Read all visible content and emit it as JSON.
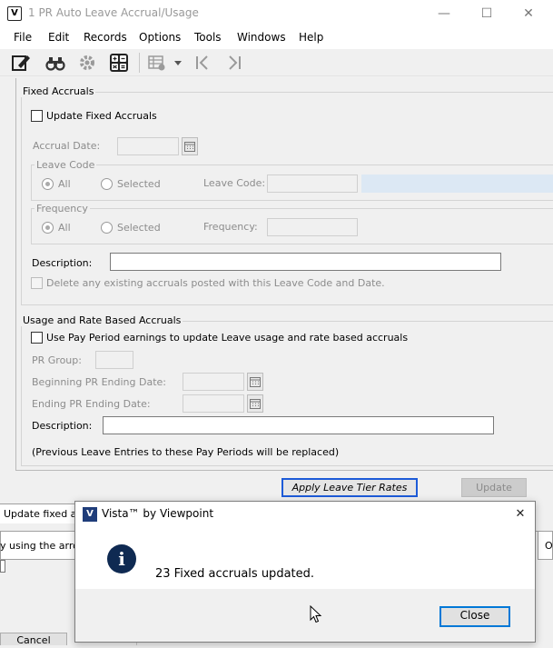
{
  "window": {
    "title": "1 PR Auto Leave Accrual/Usage",
    "controls": {
      "minimize": "—",
      "maximize": "☐",
      "close": "✕"
    }
  },
  "menu": {
    "items": [
      "File",
      "Edit",
      "Records",
      "Options",
      "Tools",
      "Windows",
      "Help"
    ]
  },
  "toolbar": {
    "icons": [
      "edit-note-icon",
      "binoculars-icon",
      "gear-icon",
      "calculator-icon",
      "grid-settings-icon",
      "dropdown-arrow-icon",
      "first-record-icon",
      "last-record-icon"
    ]
  },
  "fixed_accruals": {
    "group_title": "Fixed Accruals",
    "update_checkbox_label": "Update Fixed Accruals",
    "accrual_date_label": "Accrual Date:",
    "accrual_date_value": "",
    "leave_code_group_title": "Leave Code",
    "leave_code_all": "All",
    "leave_code_selected": "Selected",
    "leave_code_field_label": "Leave Code:",
    "leave_code_value": "",
    "frequency_group_title": "Frequency",
    "frequency_all": "All",
    "frequency_selected": "Selected",
    "frequency_field_label": "Frequency:",
    "frequency_value": "",
    "description_label": "Description:",
    "description_value": "",
    "delete_checkbox_label": "Delete any existing accruals posted with this Leave Code and Date."
  },
  "usage_accruals": {
    "group_title": "Usage and Rate Based Accruals",
    "use_pay_period_label": "Use Pay Period earnings to update Leave usage and rate based accruals",
    "pr_group_label": "PR Group:",
    "pr_group_value": "",
    "beginning_label": "Beginning PR Ending Date:",
    "beginning_value": "",
    "ending_label": "Ending PR Ending Date:",
    "ending_value": "",
    "description_label": "Description:",
    "description_value": "",
    "note": "(Previous Leave Entries to these Pay Periods will be replaced)"
  },
  "buttons": {
    "apply_tier_rates": "Apply Leave Tier Rates",
    "update": "Update"
  },
  "background": {
    "status_text": "Update fixed acc",
    "hint_text": "y using the arrow",
    "right_text": "O",
    "cancel_label": "Cancel"
  },
  "dialog": {
    "title": "Vista™ by Viewpoint",
    "message": "23 Fixed accruals updated.",
    "close_button": "Close",
    "close_x": "✕",
    "info_icon_glyph": "i",
    "app_icon_glyph": "V"
  },
  "colors": {
    "info_icon_bg": "#0f2a52",
    "focus_blue": "#1d5bd8",
    "leave_code_highlight": "#dce8f4"
  }
}
